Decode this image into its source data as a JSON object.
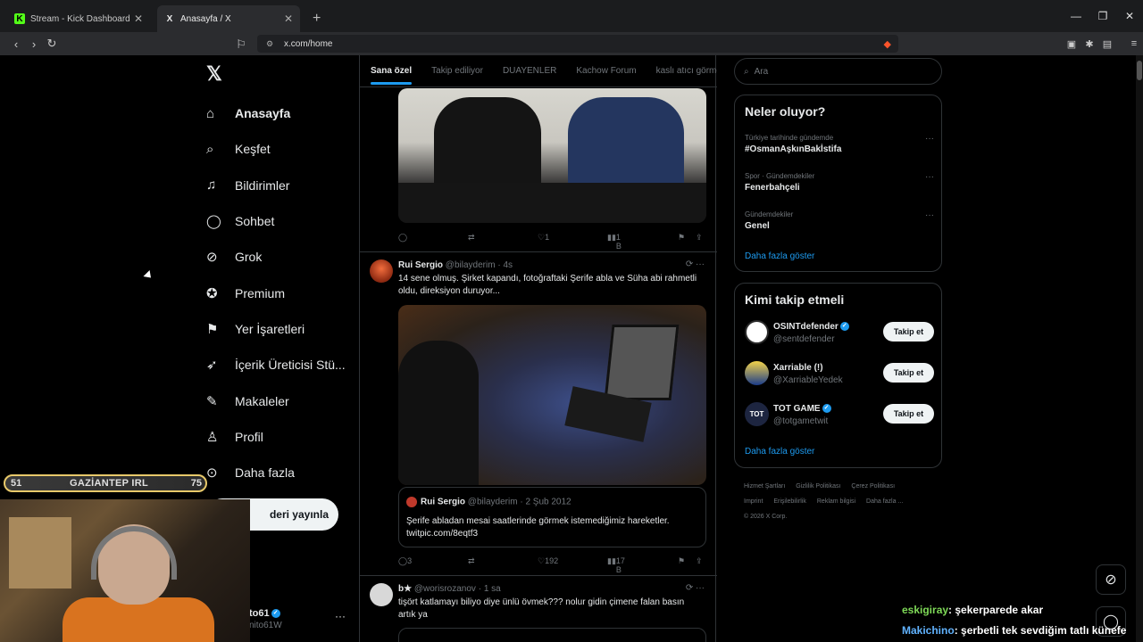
{
  "browser": {
    "tabs": [
      {
        "title": "Stream - Kick Dashboard",
        "favicon": "K"
      },
      {
        "title": "Anasayfa / X",
        "favicon": "X"
      }
    ],
    "url": "x.com/home"
  },
  "sidebar": {
    "items": [
      {
        "label": "Anasayfa",
        "icon": "home-icon"
      },
      {
        "label": "Keşfet",
        "icon": "search-icon"
      },
      {
        "label": "Bildirimler",
        "icon": "bell-icon"
      },
      {
        "label": "Sohbet",
        "icon": "chat-icon"
      },
      {
        "label": "Grok",
        "icon": "grok-icon"
      },
      {
        "label": "Premium",
        "icon": "verified-icon"
      },
      {
        "label": "Yer İşaretleri",
        "icon": "bookmark-icon"
      },
      {
        "label": "İçerik Üreticisi Stü...",
        "icon": "rocket-icon"
      },
      {
        "label": "Makaleler",
        "icon": "article-icon"
      },
      {
        "label": "Profil",
        "icon": "person-icon"
      },
      {
        "label": "Daha fazla",
        "icon": "more-circle-icon"
      }
    ],
    "post_button": "deri yayınla",
    "profile": {
      "name": "to61",
      "handle": "nito61W"
    }
  },
  "timeline": {
    "tabs": [
      "Sana özel",
      "Takip ediliyor",
      "DUAYENLER",
      "Kachow Forum",
      "kaslı atıcı görmel"
    ],
    "tweet1": {
      "likes": "1",
      "views": "1 B"
    },
    "tweet2": {
      "name": "Rui Sergio",
      "handle": "@bilayderim",
      "time": "4s",
      "text": "14 sene olmuş. Şirket kapandı, fotoğraftaki Şerife abla ve Süha abi rahmetli oldu, direksiyon duruyor...",
      "quote": {
        "name": "Rui Sergio",
        "handle": "@bilayderim",
        "date": "2 Şub 2012",
        "text": "Şerife abladan mesai saatlerinde görmek istemediğimiz hareketler. twitpic.com/8eqtf3"
      },
      "replies": "3",
      "likes": "192",
      "views": "17 B"
    },
    "tweet3": {
      "name": "b★",
      "handle": "@worisrozanov",
      "time": "1 sa",
      "text": "tişört katlamayı biliyo diye ünlü övmek??? nolur gidin çimene falan basın artık ya"
    }
  },
  "right": {
    "search_placeholder": "Ara",
    "trends_title": "Neler oluyor?",
    "trends": [
      {
        "category": "Türkiye tarihinde gündemde",
        "name": "#OsmanAşkınBakİstifa"
      },
      {
        "category": "Spor · Gündemdekiler",
        "name": "Fenerbahçeli"
      },
      {
        "category": "Gündemdekiler",
        "name": "Genel"
      }
    ],
    "show_more": "Daha fazla göster",
    "who_title": "Kimi takip etmeli",
    "who": [
      {
        "name": "OSINTdefender",
        "handle": "@sentdefender",
        "verified": true
      },
      {
        "name": "Xarriable (!)",
        "handle": "@XarriableYedek",
        "verified": false
      },
      {
        "name": "TOT GAME",
        "handle": "@totgametwit",
        "verified": true
      }
    ],
    "follow_label": "Takip et",
    "footer": [
      "Hizmet Şartları",
      "Gizlilik Politikası",
      "Çerez Politikası",
      "Imprint",
      "Erişilebilirlik",
      "Reklam bilgisi",
      "Daha fazla ...",
      "© 2026 X Corp."
    ]
  },
  "stream_overlay": {
    "bar_left": "51",
    "bar_center": "GAZİANTEP IRL",
    "bar_right": "75",
    "chat": [
      {
        "user": "eskigiray",
        "message": ": şekerparede akar"
      },
      {
        "user": "Makichino",
        "message": ": şerbetli tek sevdiğim tatlı künefe"
      }
    ]
  },
  "colors": {
    "accent": "#1d9bf0",
    "background": "#000000",
    "border": "#2f3336",
    "muted": "#71767b"
  }
}
